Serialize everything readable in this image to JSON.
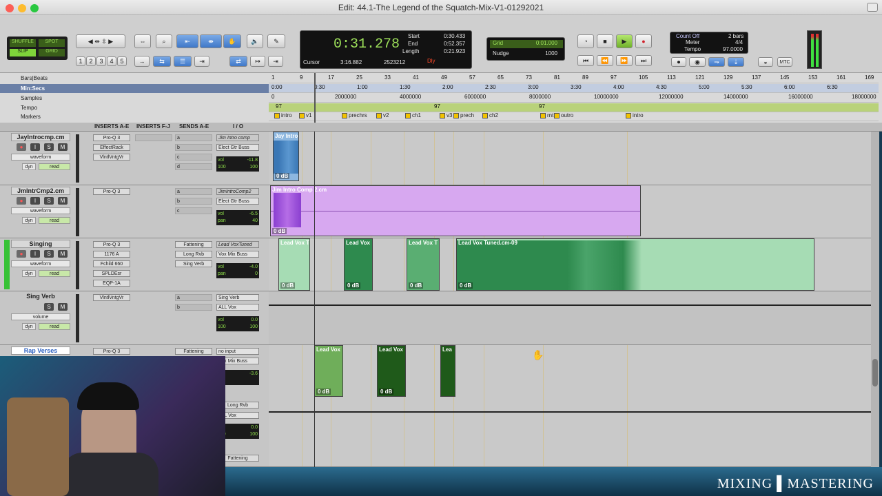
{
  "window": {
    "title": "Edit: 44.1-The Legend of the Squatch-Mix-V1-01292021"
  },
  "modes": {
    "shuffle": "SHUFFLE",
    "spot": "SPOT",
    "slip": "SLIP",
    "grid": "GRID"
  },
  "zoom_presets": [
    "1",
    "2",
    "3",
    "4",
    "5"
  ],
  "counter": {
    "main": "0:31.278",
    "start_label": "Start",
    "start": "0:30.433",
    "end_label": "End",
    "end": "0:52.357",
    "length_label": "Length",
    "length": "0:21.923",
    "cursor_label": "Cursor",
    "cursor": "3:16.882",
    "samples": "2523212",
    "dly": "Dly"
  },
  "grid": {
    "label": "Grid",
    "value": "0:01.000",
    "nudge_label": "Nudge",
    "nudge": "1000"
  },
  "count": {
    "count_off": "Count Off",
    "bars": "2 bars",
    "meter_label": "Meter",
    "meter": "4/4",
    "tempo_label": "Tempo",
    "tempo": "97.0000",
    "mtc": "MTC"
  },
  "rulers": {
    "labels": [
      "Bars|Beats",
      "Min:Secs",
      "Samples",
      "Tempo",
      "Markers"
    ],
    "bars": [
      "1",
      "9",
      "17",
      "25",
      "33",
      "41",
      "49",
      "57",
      "65",
      "73",
      "81",
      "89",
      "97",
      "105",
      "113",
      "121",
      "129",
      "137",
      "145",
      "153",
      "161",
      "169"
    ],
    "mins": [
      "0:00",
      "0:30",
      "1:00",
      "1:30",
      "2:00",
      "2:30",
      "3:00",
      "3:30",
      "4:00",
      "4:30",
      "5:00",
      "5:30",
      "6:00",
      "6:30"
    ],
    "samples": [
      "0",
      "2000000",
      "4000000",
      "6000000",
      "8000000",
      "10000000",
      "12000000",
      "14000000",
      "16000000",
      "18000000"
    ],
    "tempo_marks": [
      "97",
      "97",
      "97"
    ],
    "markers": [
      "intro",
      "v1",
      "prechrs",
      "v2",
      "ch1",
      "v3",
      "prech",
      "ch2",
      "rnt",
      "outro",
      "intro"
    ]
  },
  "columns": {
    "inserts_ae": "INSERTS A-E",
    "inserts_fj": "INSERTS F-J",
    "sends_ae": "SENDS A-E",
    "io": "I / O"
  },
  "tracks": [
    {
      "name": "JayIntrocmp.cm",
      "view": "waveform",
      "dyn": "dyn",
      "mode": "read",
      "inserts": [
        "Pro-Q 3",
        "EffectRack",
        "VlntlVntgVr"
      ],
      "sends": [],
      "io_in": "Jim Intro comp",
      "io_out": "Elect Gtr Buss",
      "vol_label": "vol",
      "vol": "-11.8",
      "pan": "100",
      "pan2": "100"
    },
    {
      "name": "JmIntrCmp2.cm",
      "view": "waveform",
      "dyn": "dyn",
      "mode": "read",
      "inserts": [
        "Pro-Q 3"
      ],
      "sends": [],
      "io_in": "JimIntroComp2",
      "io_out": "Elect Gtr Buss",
      "vol_label": "vol",
      "vol": "-6.5",
      "pan_label": "pan",
      "pan": "40"
    },
    {
      "name": "Singing",
      "view": "waveform",
      "dyn": "dyn",
      "mode": "read",
      "inserts": [
        "Pro-Q 3",
        "1176 A",
        "Fchild 660",
        "SPLDEsr",
        "EQP-1A"
      ],
      "sends": [
        "Fattening",
        "Long Rvb",
        "Sing Verb"
      ],
      "io_in": "Lead VoxTuned",
      "io_out": "Vox Mix Buss",
      "vol_label": "vol",
      "vol": "-4.0",
      "pan_label": "pan",
      "pan": "0"
    },
    {
      "name": "Sing Verb",
      "view": "volume",
      "dyn": "dyn",
      "mode": "read",
      "inserts": [
        "VlntlVntgVr"
      ],
      "sends": [],
      "io_in": "Sing Verb",
      "io_out": "ALL Vox",
      "vol_label": "vol",
      "vol": "0.0",
      "pan": "100",
      "pan2": "100"
    },
    {
      "name": "Rap Verses",
      "inserts": [
        "Pro-Q 3"
      ],
      "sends": [
        "Fattening",
        "Long Rvb",
        "Fattening"
      ],
      "io_in": "no input",
      "io_out": "Vox Mix Buss",
      "vol": "-3.6",
      "io2": "ALL Vox",
      "vol2": "0.0",
      "pan": "100",
      "pan2": "100"
    }
  ],
  "clips": {
    "jay": {
      "name": "Jay Intro",
      "gain": "0 dB"
    },
    "jim": {
      "name": "Jim Intro Comp 2.cm",
      "gain": "0 dB"
    },
    "lv1": {
      "name": "Lead Vox T",
      "gain": "0 dB"
    },
    "lv2": {
      "name": "Lead Vox",
      "gain": "0 dB"
    },
    "lv3": {
      "name": "Lead Vox T",
      "gain": "0 dB"
    },
    "lv4": {
      "name": "Lead Vox Tuned.cm-09",
      "gain": "0 dB"
    },
    "rv1": {
      "name": "Lead Vox",
      "gain": "0 dB"
    },
    "rv2": {
      "name": "Lead Vox",
      "gain": "0 dB"
    },
    "rv3": {
      "name": "Lea"
    }
  },
  "overlay": {
    "logo": "MIXING ▌MASTERING"
  }
}
